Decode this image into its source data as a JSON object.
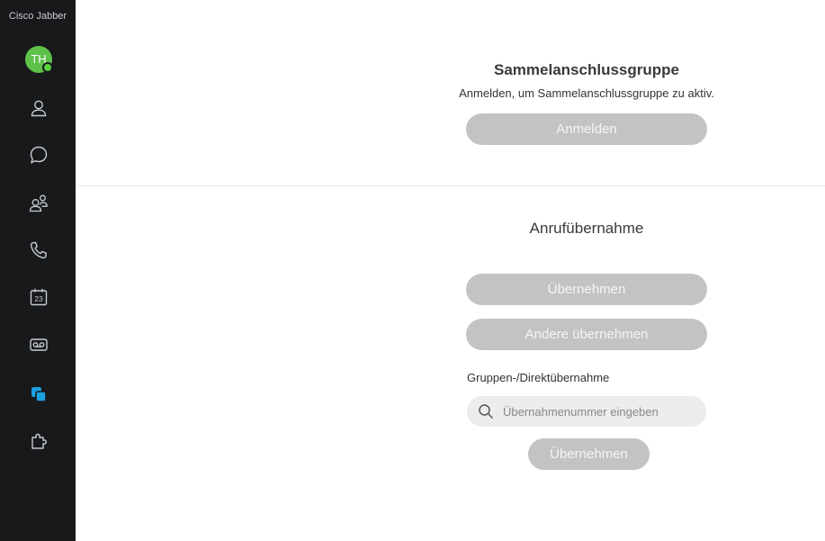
{
  "sidebar": {
    "app_title": "Cisco Jabber",
    "avatar_initials": "TH",
    "presence_color": "#5bd23a",
    "items": [
      {
        "icon": "contacts-icon"
      },
      {
        "icon": "chats-icon"
      },
      {
        "icon": "meetings-icon"
      },
      {
        "icon": "phone-icon"
      },
      {
        "icon": "calendar-icon",
        "day": "23"
      },
      {
        "icon": "voicemail-icon"
      },
      {
        "icon": "call-pickup-icon",
        "active": true,
        "color": "#1ba0e1"
      },
      {
        "icon": "custom-tab-icon"
      }
    ]
  },
  "hunt_group": {
    "title": "Sammelanschlussgruppe",
    "subtitle": "Anmelden, um Sammelanschlussgruppe zu aktiv.",
    "sign_in_label": "Anmelden"
  },
  "call_pickup": {
    "title": "Anrufübernahme",
    "pickup_label": "Übernehmen",
    "other_pickup_label": "Andere übernehmen",
    "group_direct_label": "Gruppen-/Direktübernahme",
    "search_placeholder": "Übernahmenummer eingeben",
    "search_value": "",
    "direct_pickup_label": "Übernehmen"
  }
}
